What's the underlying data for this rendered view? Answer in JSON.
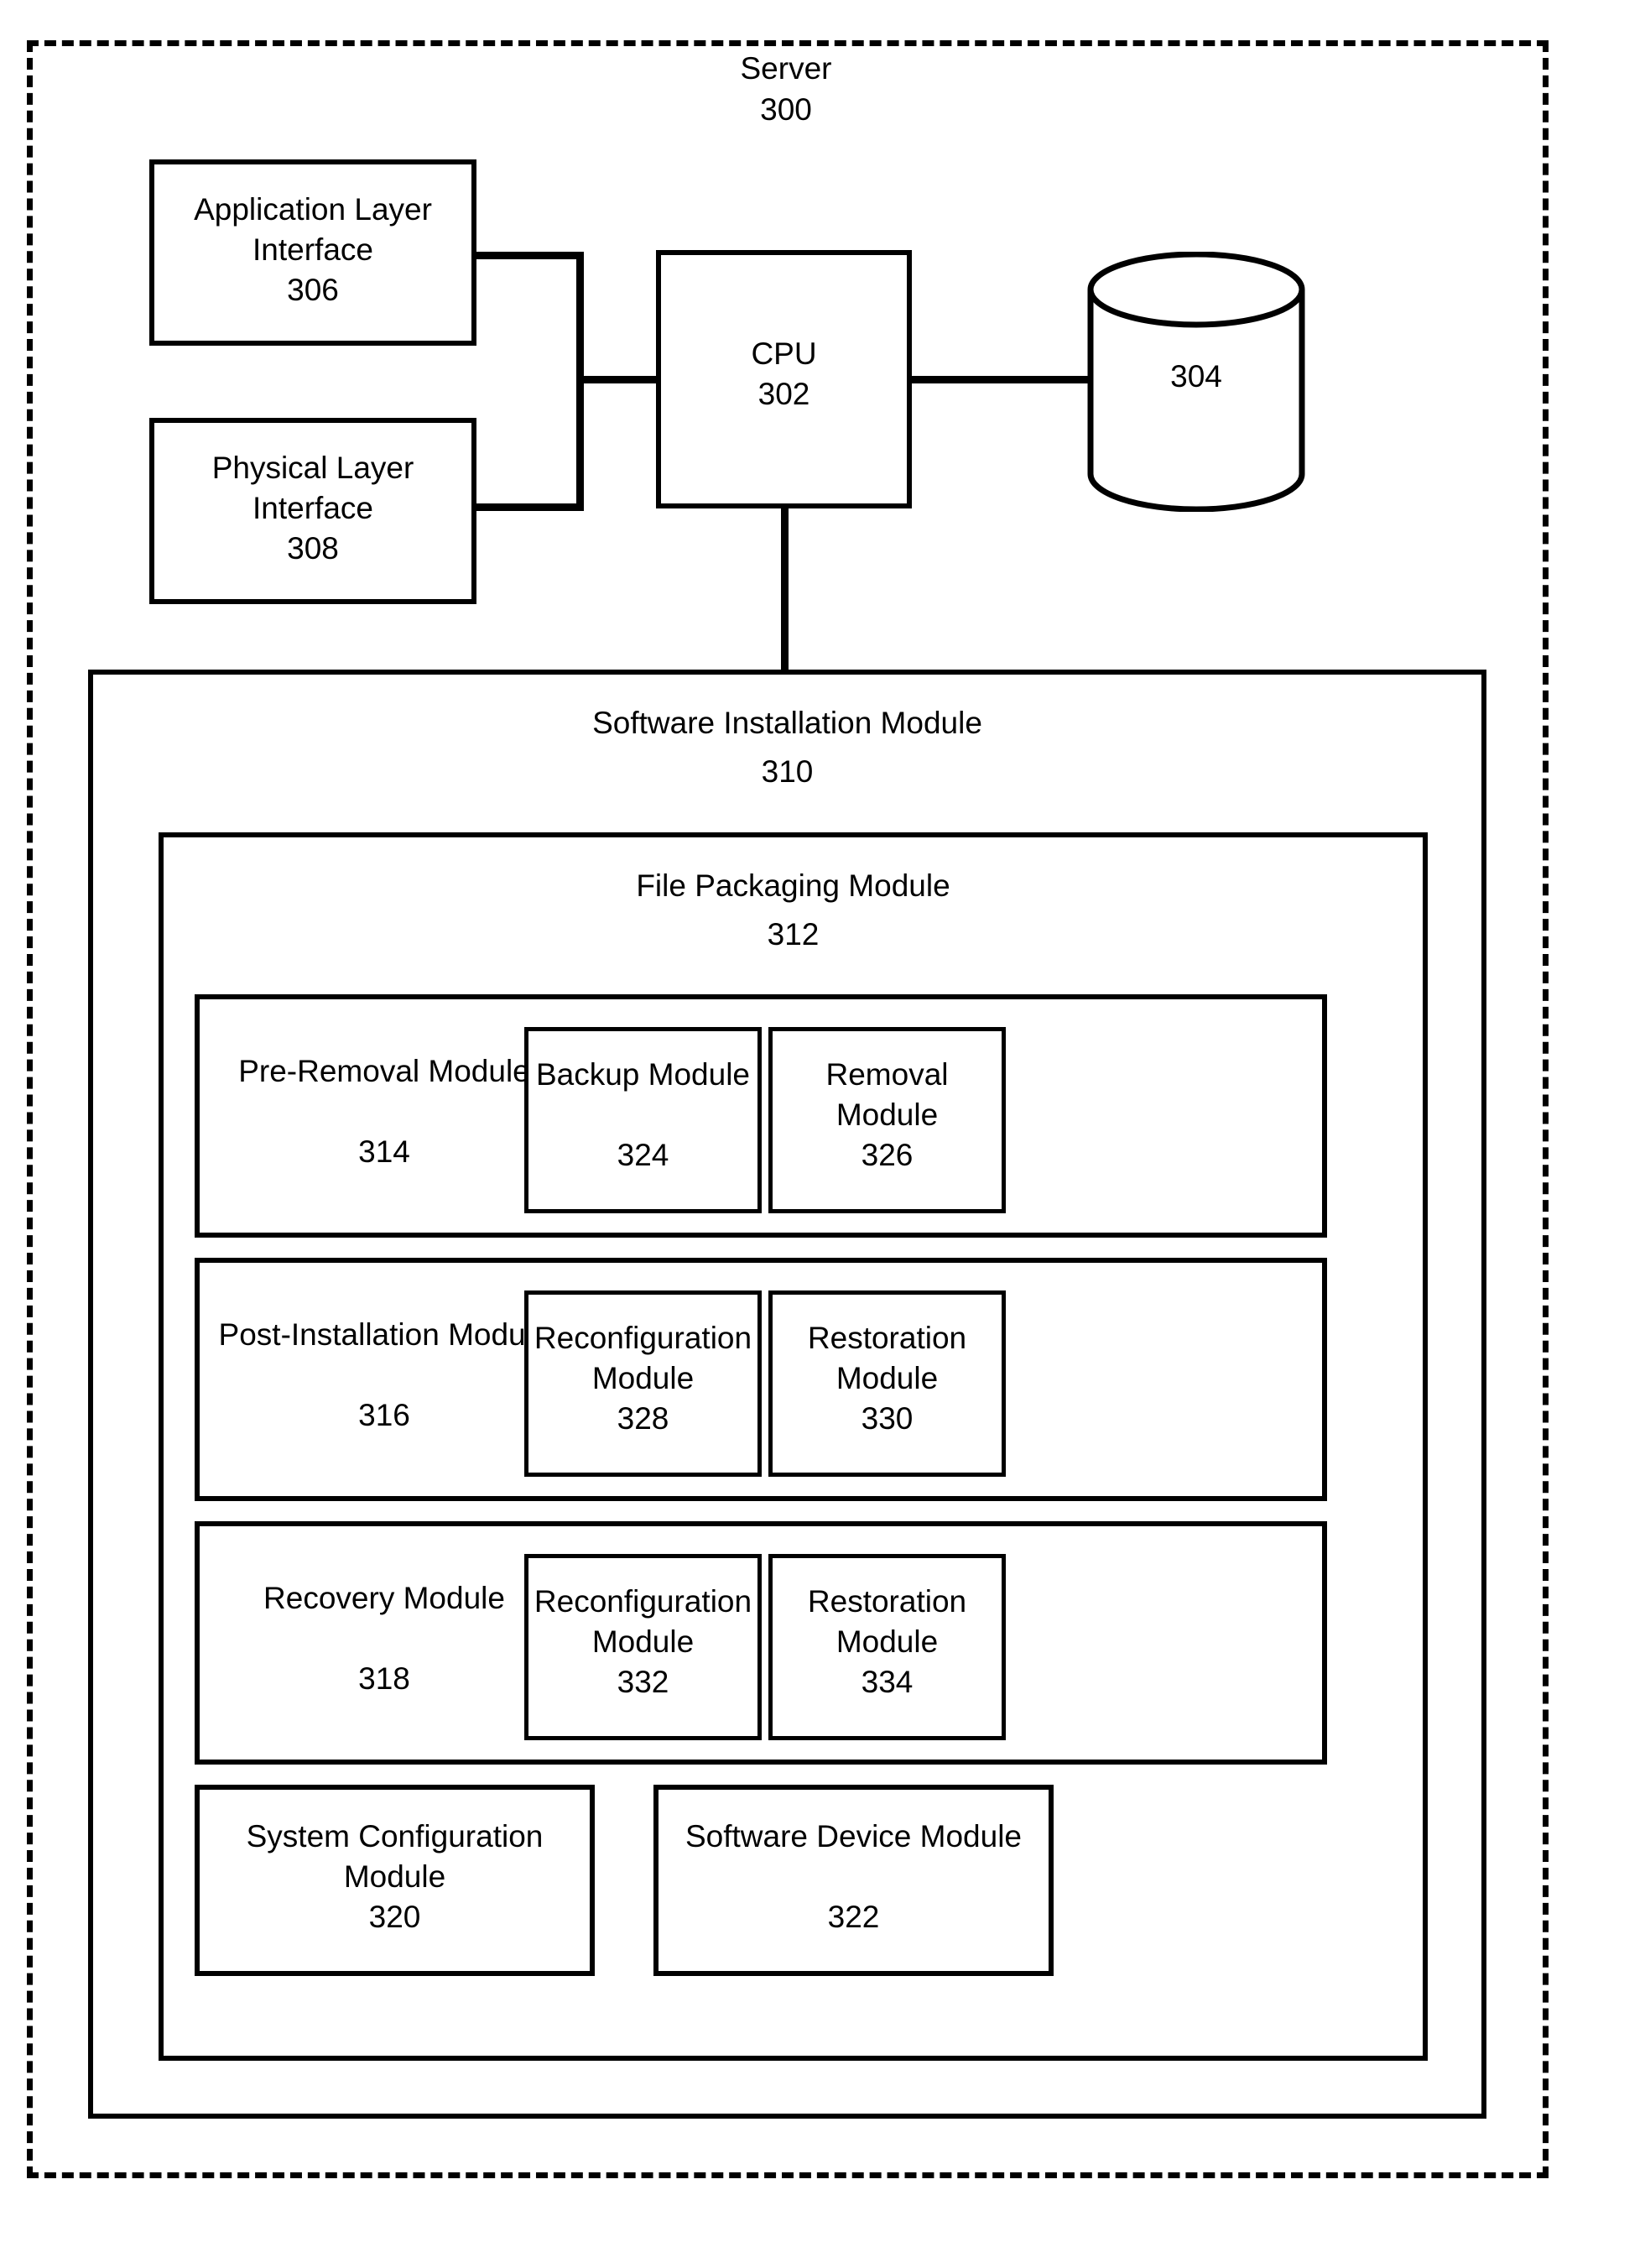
{
  "figure": {
    "server": {
      "title": "Server",
      "ref": "300"
    },
    "cpu": {
      "title": "CPU",
      "ref": "302"
    },
    "database": {
      "ref": "304"
    },
    "app_layer": {
      "title": "Application Layer\nInterface",
      "ref": "306"
    },
    "phys_layer": {
      "title": "Physical Layer\nInterface",
      "ref": "308"
    },
    "software_install": {
      "title": "Software Installation Module",
      "ref": "310"
    },
    "file_packaging": {
      "title": "File Packaging Module",
      "ref": "312"
    },
    "rows": [
      {
        "outer": {
          "title": "Pre-Removal\nModule",
          "ref": "314"
        },
        "inner": [
          {
            "title": "Backup\nModule",
            "ref": "324"
          },
          {
            "title": "Removal\nModule",
            "ref": "326"
          }
        ]
      },
      {
        "outer": {
          "title": "Post-Installation\nModule",
          "ref": "316"
        },
        "inner": [
          {
            "title": "Reconfiguration\nModule",
            "ref": "328"
          },
          {
            "title": "Restoration\nModule",
            "ref": "330"
          }
        ]
      },
      {
        "outer": {
          "title": "Recovery\nModule",
          "ref": "318"
        },
        "inner": [
          {
            "title": "Reconfiguration\nModule",
            "ref": "332"
          },
          {
            "title": "Restoration\nModule",
            "ref": "334"
          }
        ]
      }
    ],
    "bottom_modules": [
      {
        "title": "System Configuration\nModule",
        "ref": "320"
      },
      {
        "title": "Software Device\nModule",
        "ref": "322"
      }
    ],
    "colors": {
      "ink": "#000000",
      "paper": "#ffffff"
    }
  }
}
